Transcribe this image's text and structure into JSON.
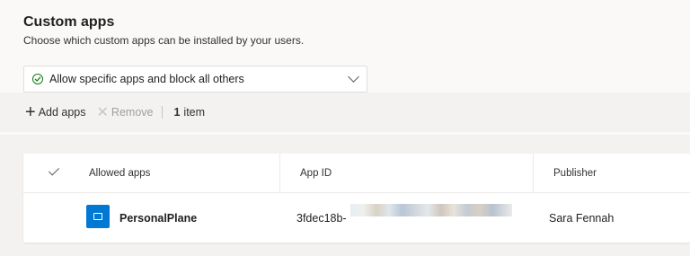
{
  "section": {
    "title": "Custom apps",
    "subtitle": "Choose which custom apps can be installed by your users."
  },
  "policy_dropdown": {
    "selected": "Allow specific apps and block all others",
    "icon": "check-circle-icon"
  },
  "toolbar": {
    "add_label": "Add apps",
    "remove_label": "Remove",
    "count_number": "1",
    "count_unit": "item"
  },
  "table": {
    "columns": [
      "Allowed apps",
      "App ID",
      "Publisher"
    ],
    "rows": [
      {
        "app_name": "PersonalPlane",
        "app_id": "3fdec18b-",
        "publisher": "Sara Fennah",
        "app_icon": "app-tile-icon"
      }
    ]
  },
  "colors": {
    "accent": "#0078d4",
    "success": "#107c10"
  }
}
